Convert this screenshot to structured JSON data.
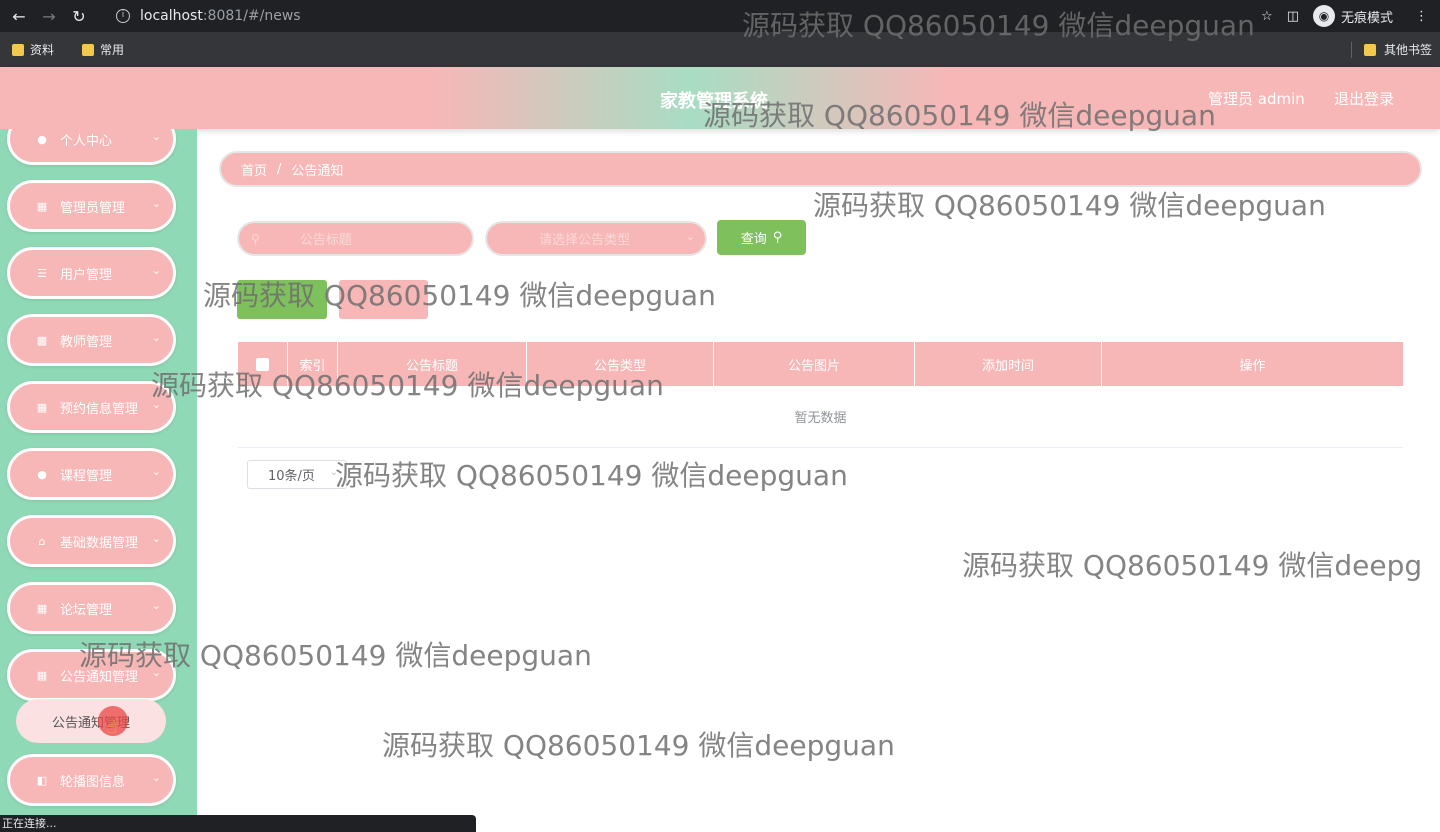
{
  "browser": {
    "url_host": "localhost",
    "url_path": ":8081/#/news",
    "incognito_label": "无痕模式",
    "bookmarks": [
      "资料",
      "常用"
    ],
    "other_bookmarks": "其他书签",
    "status_text": "正在连接..."
  },
  "header": {
    "title": "家教管理系统",
    "user": "管理员 admin",
    "logout": "退出登录"
  },
  "sidebar": {
    "items": [
      {
        "label": "个人中心",
        "icon": "user-icon"
      },
      {
        "label": "管理员管理",
        "icon": "grid-icon"
      },
      {
        "label": "用户管理",
        "icon": "list-icon"
      },
      {
        "label": "教师管理",
        "icon": "clipboard-icon"
      },
      {
        "label": "预约信息管理",
        "icon": "grid-icon"
      },
      {
        "label": "课程管理",
        "icon": "user-icon"
      },
      {
        "label": "基础数据管理",
        "icon": "home-icon"
      },
      {
        "label": "论坛管理",
        "icon": "grid-icon"
      },
      {
        "label": "公告通知管理",
        "icon": "grid-icon"
      },
      {
        "label": "轮播图信息",
        "icon": "image-icon"
      }
    ],
    "sub_item": "公告通知管理"
  },
  "breadcrumb": {
    "home": "首页",
    "sep": "/",
    "current": "公告通知"
  },
  "search": {
    "title_placeholder": "公告标题",
    "type_placeholder": "请选择公告类型",
    "query_label": "查询"
  },
  "table": {
    "columns": [
      "索引",
      "公告标题",
      "公告类型",
      "公告图片",
      "添加时间",
      "操作"
    ],
    "empty_text": "暂无数据"
  },
  "pagination": {
    "page_size": "10条/页"
  },
  "watermarks": [
    "源码获取 QQ86050149 微信deepguan",
    "源码获取 QQ86050149 微信deepguan",
    "源码获取 QQ86050149 微信deepguan",
    "源码获取 QQ86050149 微信deepguan",
    "源码获取 QQ86050149 微信deepguan",
    "源码获取 QQ86050149 微信deepguan",
    "源码获取 QQ86050149 微信deepg",
    "源码获取 QQ86050149 微信deepguan",
    "源码获取 QQ86050149 微信deepguan"
  ]
}
